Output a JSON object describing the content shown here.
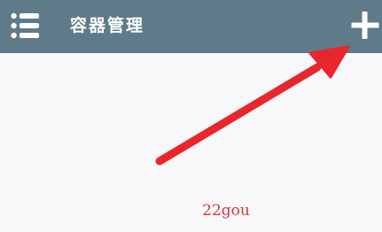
{
  "app_bar": {
    "title": "容器管理",
    "background_color": "#5f7a88",
    "menu_icon": "menu-list-icon",
    "add_icon": "plus-icon",
    "icon_color": "#ffffff"
  },
  "annotation": {
    "arrow_color": "#e8262c",
    "watermark": "22gou",
    "watermark_color": "#d23a3a"
  },
  "content": {
    "background_color": "#f8f8fa"
  }
}
